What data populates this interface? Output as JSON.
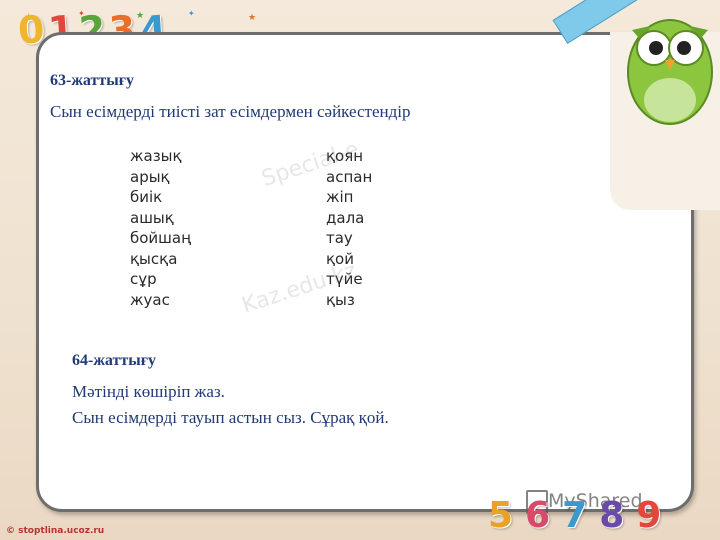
{
  "header": {
    "digits": [
      "0",
      "1",
      "2",
      "3",
      "4"
    ]
  },
  "exercise63": {
    "title": "63-жаттығу",
    "instruction": "Сын есімдерді тиісті зат есімдермен сәйкестендір"
  },
  "word_table": {
    "left": [
      "жазық",
      "арық",
      "биік",
      "ашық",
      "бойшаң",
      "қысқа",
      "сұр",
      "жуас"
    ],
    "right": [
      "қоян",
      "аспан",
      "жіп",
      "дала",
      "тау",
      "қой",
      "түйе",
      "қыз"
    ],
    "watermarks": [
      "Special-e",
      "Kaz.edu.kz"
    ]
  },
  "exercise64": {
    "title": "64-жаттығу",
    "line1": "Мәтінді көшіріп жаз.",
    "line2": "Сын есімдерді тауып астын сыз. Сұрақ қой."
  },
  "footer": {
    "digits": [
      "5",
      "6",
      "7",
      "8",
      "9"
    ],
    "watermark": "MyShared",
    "credit": "© stoptlina.ucoz.ru"
  },
  "colors": {
    "text_blue": "#1f3a75",
    "card_border": "#6d6d6d",
    "background": "#f4e9da"
  }
}
